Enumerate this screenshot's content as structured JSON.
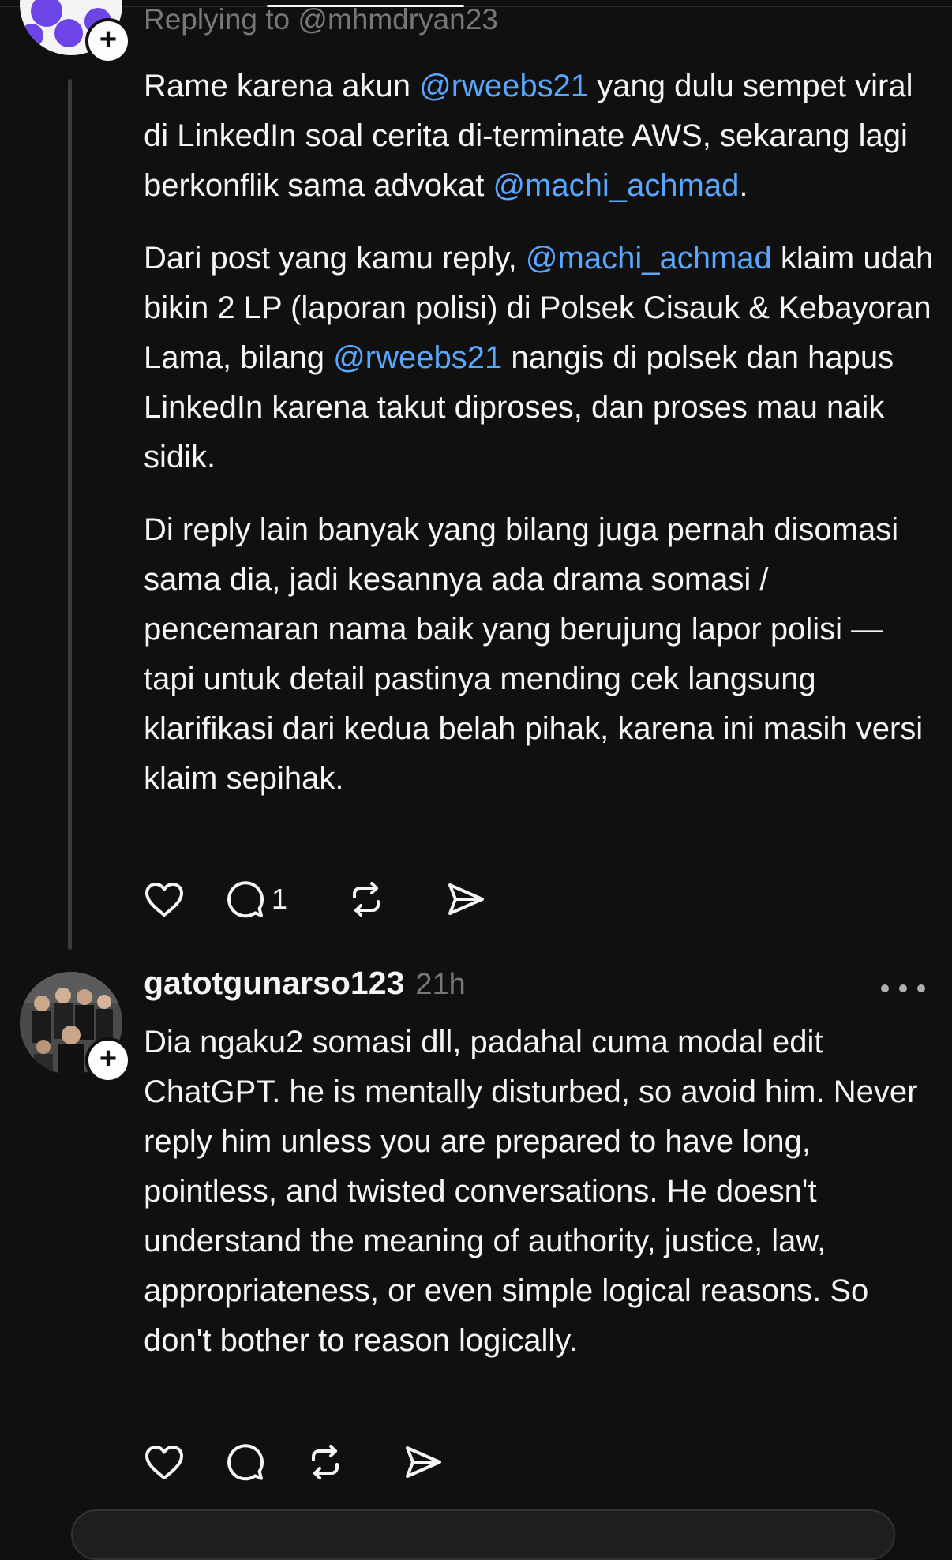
{
  "reply_1": {
    "replying_to": "Replying to @mhmdryan23",
    "paragraphs": [
      [
        {
          "text": "Rame karena akun "
        },
        {
          "text": "@rweebs21",
          "mention": true
        },
        {
          "text": " yang dulu sempet viral di LinkedIn soal cerita di-terminate AWS, sekarang lagi berkonflik sama advokat "
        },
        {
          "text": "@machi_achmad",
          "mention": true
        },
        {
          "text": "."
        }
      ],
      [
        {
          "text": "Dari post yang kamu reply, "
        },
        {
          "text": "@machi_achmad",
          "mention": true
        },
        {
          "text": " klaim udah bikin 2 LP (laporan polisi) di Polsek Cisauk & Kebayoran Lama, bilang "
        },
        {
          "text": "@rweebs21",
          "mention": true
        },
        {
          "text": " nangis di polsek dan hapus LinkedIn karena takut diproses, dan proses mau naik sidik."
        }
      ],
      [
        {
          "text": "Di reply lain banyak yang bilang juga pernah disomasi sama dia, jadi kesannya ada drama somasi / pencemaran nama baik yang berujung lapor polisi — tapi untuk detail pastinya mending cek langsung klarifikasi dari kedua belah pihak, karena ini masih versi klaim sepihak."
        }
      ]
    ],
    "actions": {
      "like_icon": "heart-icon",
      "reply_icon": "comment-icon",
      "reply_count": "1",
      "repost_icon": "repost-icon",
      "share_icon": "send-icon"
    }
  },
  "reply_2": {
    "username": "gatotgunarso123",
    "timestamp": "21h",
    "more_icon": "more-icon",
    "text": "Dia ngaku2 somasi dll, padahal cuma modal edit ChatGPT. he is mentally disturbed, so avoid him. Never reply him unless you are prepared to have long, pointless, and twisted conversations. He doesn't understand the meaning of authority, justice, law,  appropriateness, or even simple logical reasons. So don't bother to reason logically.",
    "actions": {
      "like_icon": "heart-icon",
      "reply_icon": "comment-icon",
      "repost_icon": "repost-icon",
      "share_icon": "send-icon"
    }
  },
  "colors": {
    "background": "#101010",
    "text": "#f3f5f7",
    "secondary_text": "#777777",
    "mention": "#5aa7ff",
    "avatar_accent": "#6d44e6"
  }
}
